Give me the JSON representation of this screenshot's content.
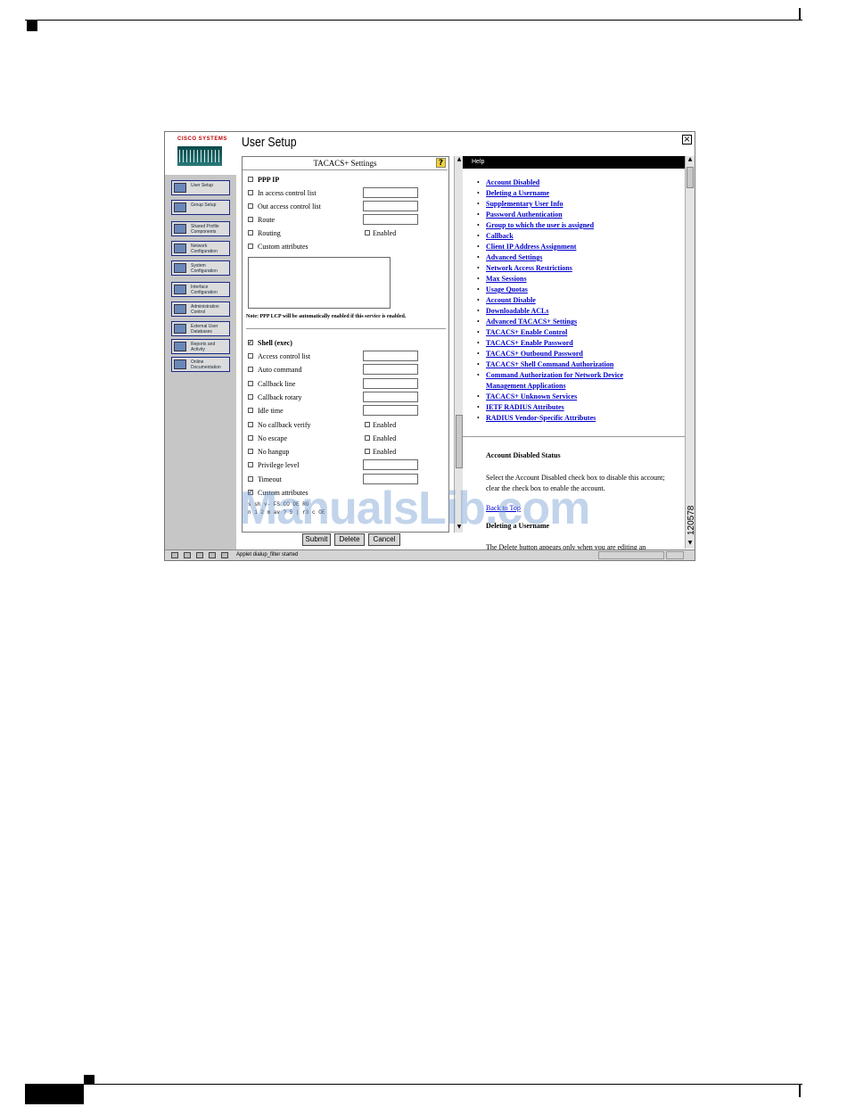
{
  "figure_id": "120578",
  "watermark": "ManualsLib.com",
  "window": {
    "title": "User Setup",
    "close_glyph": "×"
  },
  "logo": {
    "text": "CISCO SYSTEMS"
  },
  "sidebar": {
    "items": [
      {
        "label": "User Setup",
        "icon": "user-icon"
      },
      {
        "label": "Group Setup",
        "icon": "group-icon"
      },
      {
        "label": "Shared Profile Components",
        "icon": "shared-profile-icon"
      },
      {
        "label": "Network Configuration",
        "icon": "network-icon"
      },
      {
        "label": "System Configuration",
        "icon": "system-icon"
      },
      {
        "label": "Interface Configuration",
        "icon": "interface-icon"
      },
      {
        "label": "Administration Control",
        "icon": "admin-icon"
      },
      {
        "label": "External User Databases",
        "icon": "database-icon"
      },
      {
        "label": "Reports and Activity",
        "icon": "reports-icon"
      },
      {
        "label": "Online Documentation",
        "icon": "docs-icon"
      }
    ]
  },
  "form": {
    "header": "TACACS+ Settings",
    "help_glyph": "?",
    "ppp": {
      "label": "PPP IP",
      "rows": [
        "In access control list",
        "Out access control list",
        "Route",
        "Routing",
        "Custom attributes"
      ],
      "enabled_label": "Enabled"
    },
    "note": "Note: PPP LCP will be automatically enabled if this service is enabled.",
    "shell": {
      "label": "Shell (exec)",
      "rows": [
        "Access control list",
        "Auto command",
        "Callback line",
        "Callback rotary",
        "Idle time",
        "No callback verify",
        "No escape",
        "No hangup",
        "Privilege level",
        "Timeout",
        "Custom attributes"
      ],
      "enabled_label": "Enabled"
    },
    "code_lines": [
      "s sh v-  FS  CO  DE  RO",
      "n 1 2  m   av  ? 5 |  r3 c  OE"
    ]
  },
  "buttons": {
    "submit": "Submit",
    "delete": "Delete",
    "cancel": "Cancel"
  },
  "help": {
    "header": "Help",
    "links": [
      "Account Disabled",
      "Deleting a Username",
      "Supplementary User Info",
      "Password Authentication",
      "Group to which the user is assigned",
      "Callback",
      "Client IP Address Assignment",
      "Advanced Settings",
      "Network Access Restrictions",
      "Max Sessions",
      "Usage Quotas",
      "Account Disable",
      "Downloadable ACLs",
      "Advanced TACACS+ Settings",
      "TACACS+ Enable Control",
      "TACACS+ Enable Password",
      "TACACS+ Outbound Password",
      "TACACS+ Shell Command Authorization",
      "Command Authorization for Network Device",
      "Management Applications",
      "TACACS+ Unknown Services",
      "IETF RADIUS Attributes",
      "RADIUS Vendor-Specific Attributes"
    ],
    "section_title": "Account Disabled Status",
    "section_text": "Select the Account Disabled check box to disable this account; clear the check box to enable the account.",
    "back_to_top": "Back to Top",
    "next_title": "Deleting a Username",
    "next_text_cut": "The Delete button appears only when you are editing an"
  },
  "statusbar": {
    "text": "Applet dialup_filter started"
  }
}
